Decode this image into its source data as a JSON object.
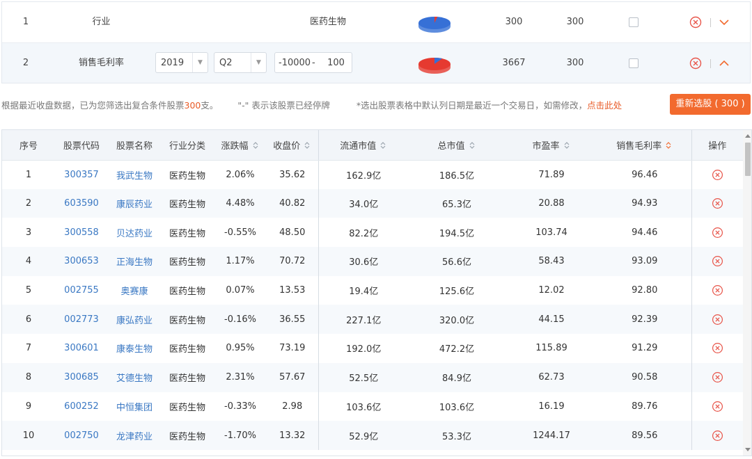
{
  "conditions": [
    {
      "index": "1",
      "name": "行业",
      "value": "医药生物",
      "count_a": "300",
      "count_b": "300",
      "pie": {
        "main_color": "#3670d6",
        "slice_color": "#e63a30",
        "slice_fraction": 0.03
      },
      "expand_icon": "chevron-down-icon"
    },
    {
      "index": "2",
      "name": "销售毛利率",
      "year": "2019",
      "quarter": "Q2",
      "range_min": "-10000",
      "range_sep": "-",
      "range_max": "100",
      "count_a": "3667",
      "count_b": "300",
      "pie": {
        "main_color": "#e63a30",
        "slice_color": "#3670d6",
        "slice_fraction": 0.08
      },
      "expand_icon": "chevron-up-icon"
    }
  ],
  "summary": {
    "prefix": "根据最近收盘数据，已为您筛选出复合条件股票",
    "count": "300",
    "suffix": "支。",
    "suspend_note": "\"-\" 表示该股票已经停牌",
    "date_note": "*选出股票表格中默认列日期是最近一个交易日，如需修改，",
    "link": "点击此处"
  },
  "reselect_button": "重新选股 ( 300 )",
  "table": {
    "headers": [
      "序号",
      "股票代码",
      "股票名称",
      "行业分类",
      "涨跌幅",
      "收盘价",
      "流通市值",
      "总市值",
      "市盈率",
      "销售毛利率",
      "操作"
    ],
    "rows": [
      [
        "1",
        "300357",
        "我武生物",
        "医药生物",
        "2.06%",
        "35.62",
        "162.9亿",
        "186.5亿",
        "71.89",
        "96.46"
      ],
      [
        "2",
        "603590",
        "康辰药业",
        "医药生物",
        "4.48%",
        "40.82",
        "34.0亿",
        "65.3亿",
        "20.88",
        "94.93"
      ],
      [
        "3",
        "300558",
        "贝达药业",
        "医药生物",
        "-0.55%",
        "48.50",
        "82.2亿",
        "194.5亿",
        "103.74",
        "94.46"
      ],
      [
        "4",
        "300653",
        "正海生物",
        "医药生物",
        "1.17%",
        "70.72",
        "30.6亿",
        "56.6亿",
        "58.43",
        "93.09"
      ],
      [
        "5",
        "002755",
        "奥赛康",
        "医药生物",
        "0.07%",
        "13.53",
        "19.4亿",
        "125.6亿",
        "12.02",
        "92.80"
      ],
      [
        "6",
        "002773",
        "康弘药业",
        "医药生物",
        "-0.16%",
        "36.55",
        "227.1亿",
        "320.0亿",
        "44.15",
        "92.39"
      ],
      [
        "7",
        "300601",
        "康泰生物",
        "医药生物",
        "0.95%",
        "73.19",
        "192.0亿",
        "472.2亿",
        "115.89",
        "91.29"
      ],
      [
        "8",
        "300685",
        "艾德生物",
        "医药生物",
        "2.31%",
        "57.67",
        "52.5亿",
        "84.9亿",
        "62.73",
        "90.58"
      ],
      [
        "9",
        "600252",
        "中恒集团",
        "医药生物",
        "-0.33%",
        "2.98",
        "103.6亿",
        "103.6亿",
        "16.19",
        "89.76"
      ],
      [
        "10",
        "002750",
        "龙津药业",
        "医药生物",
        "-1.70%",
        "13.32",
        "52.9亿",
        "53.3亿",
        "1244.17",
        "89.56"
      ]
    ]
  },
  "colors": {
    "accent": "#f26a2e",
    "link": "#3a78c3",
    "close": "#e8554a"
  }
}
